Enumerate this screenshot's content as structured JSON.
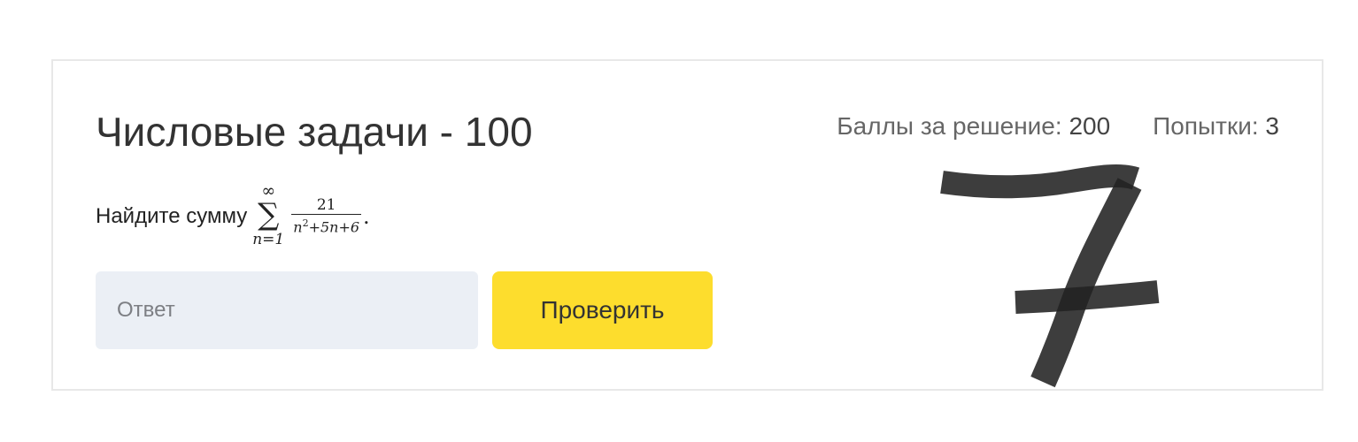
{
  "task": {
    "title": "Числовые задачи - 100",
    "score_label": "Баллы за решение:",
    "score_value": "200",
    "attempts_label": "Попытки:",
    "attempts_value": "3",
    "prompt_text": "Найдите сумму",
    "formula": {
      "sum_upper": "∞",
      "sum_symbol": "∑",
      "sum_lower": "n=1",
      "numerator": "21",
      "denominator_base": "n",
      "denominator_exp": "2",
      "denominator_rest": "+5n+6",
      "trailing": "."
    }
  },
  "answer": {
    "placeholder": "Ответ",
    "value": ""
  },
  "submit": {
    "label": "Проверить"
  },
  "handwritten_overlay": {
    "digit": "7",
    "color": "#222222"
  }
}
